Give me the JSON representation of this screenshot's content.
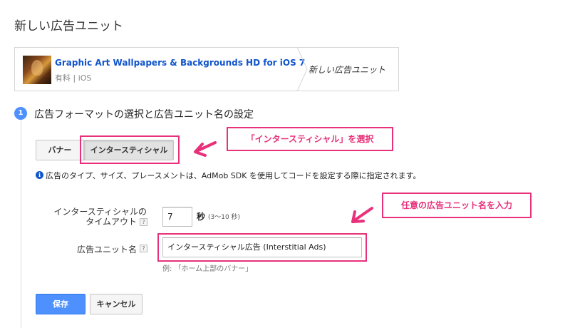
{
  "page": {
    "title": "新しい広告ユニット"
  },
  "breadcrumb": {
    "app_name": "Graphic Art Wallpapers & Backgrounds HD for iOS 7",
    "app_meta": "有料 | iOS",
    "current": "新しい広告ユニット"
  },
  "step": {
    "number": "1",
    "title": "広告フォーマットの選択と広告ユニット名の設定"
  },
  "format_tabs": [
    {
      "label": "バナー",
      "selected": false
    },
    {
      "label": "インタースティシャル",
      "selected": true
    }
  ],
  "info_text": "広告のタイプ、サイズ、プレースメントは、AdMob SDK を使用してコードを設定する際に指定されます。",
  "timeout": {
    "label_line1": "インタースティシャルの",
    "label_line2": "タイムアウト",
    "value": "7",
    "unit": "秒",
    "range": "(3〜10 秒)"
  },
  "ad_unit_name": {
    "label": "広告ユニット名",
    "value": "インタースティシャル広告 (Interstitial Ads)",
    "hint": "例: 「ホーム上部のバナー」"
  },
  "help_glyph": "?",
  "info_glyph": "i",
  "annotations": {
    "callout_tab": "「インタースティシャル」を選択",
    "callout_name": "任意の広告ユニット名を入力"
  },
  "buttons": {
    "save": "保存",
    "cancel": "キャンセル"
  },
  "colors": {
    "accent": "#4d90fe",
    "highlight": "#e8317a",
    "link": "#1155cc"
  }
}
